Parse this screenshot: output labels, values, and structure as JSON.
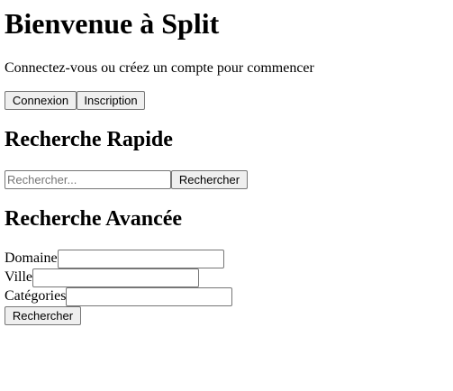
{
  "header": {
    "title": "Bienvenue à Split",
    "subtitle": "Connectez-vous ou créez un compte pour commencer"
  },
  "auth": {
    "login_label": "Connexion",
    "signup_label": "Inscription"
  },
  "quick_search": {
    "heading": "Recherche Rapide",
    "placeholder": "Rechercher...",
    "value": "",
    "button_label": "Rechercher"
  },
  "advanced_search": {
    "heading": "Recherche Avancée",
    "fields": [
      {
        "label": "Domaine",
        "value": ""
      },
      {
        "label": "Ville",
        "value": ""
      },
      {
        "label": "Catégories",
        "value": ""
      }
    ],
    "button_label": "Rechercher"
  }
}
